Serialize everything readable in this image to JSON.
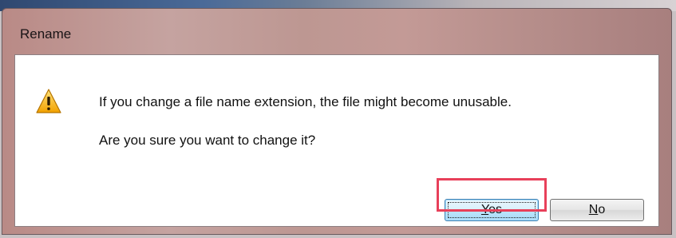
{
  "dialog": {
    "title": "Rename",
    "icon": "warning-icon",
    "message_line1": "If you change a file name extension, the file might become unusable.",
    "message_line2": "Are you sure you want to change it?",
    "buttons": {
      "yes": {
        "mnemonic": "Y",
        "rest": "es"
      },
      "no": {
        "mnemonic": "N",
        "rest": "o"
      }
    },
    "highlight_color": "#e8405a",
    "default_button": "yes"
  }
}
